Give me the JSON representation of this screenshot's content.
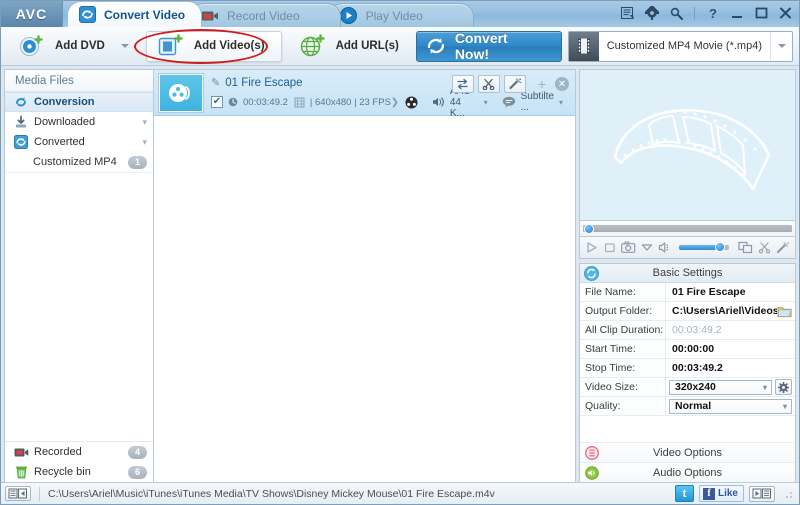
{
  "app": {
    "logo": "AVC"
  },
  "titlebar": {
    "tabs": [
      {
        "label": "Convert Video",
        "icon": "convert-icon",
        "active": true
      },
      {
        "label": "Record Video",
        "icon": "record-icon",
        "active": false
      },
      {
        "label": "Play Video",
        "icon": "play-icon",
        "active": false
      }
    ],
    "controls": [
      {
        "name": "activity-icon",
        "glyph": "▤"
      },
      {
        "name": "settings-gear-icon",
        "glyph": "✿"
      },
      {
        "name": "search-icon",
        "glyph": "🔍"
      },
      {
        "name": "help-button",
        "glyph": "?"
      },
      {
        "name": "minimize-button",
        "glyph": "—"
      },
      {
        "name": "maximize-button",
        "glyph": "❐"
      },
      {
        "name": "close-button",
        "glyph": "✕"
      }
    ]
  },
  "toolbar": {
    "add_dvd": "Add DVD",
    "add_videos": "Add Video(s)",
    "add_urls": "Add URL(s)",
    "convert_now": "Convert Now!",
    "profile": "Customized MP4 Movie (*.mp4)",
    "highlight_color": "#d21b1b"
  },
  "sidebar": {
    "header": "Media Files",
    "items": [
      {
        "label": "Conversion",
        "icon": "conversion-icon",
        "selected": true,
        "chevron": false,
        "badge": ""
      },
      {
        "label": "Downloaded",
        "icon": "downloaded-icon",
        "selected": false,
        "chevron": true,
        "badge": ""
      },
      {
        "label": "Converted",
        "icon": "converted-icon",
        "selected": false,
        "chevron": true,
        "badge": ""
      }
    ],
    "sub_item": {
      "label": "Customized MP4",
      "badge": "1"
    },
    "bottom_items": [
      {
        "label": "Recorded",
        "icon": "recorded-icon",
        "badge": "4"
      },
      {
        "label": "Recycle bin",
        "icon": "trash-icon",
        "badge": "6"
      }
    ]
  },
  "filelist": {
    "item": {
      "title": "01 Fire Escape",
      "duration": "00:03:49.2",
      "resolution": "640x480",
      "fps": "23 FPS",
      "separator": "|",
      "audio": "AAC 44 K...",
      "subtitle": "Subtilte ...",
      "checked": true
    },
    "actions": [
      {
        "name": "swap-icon",
        "glyph": "⇄"
      },
      {
        "name": "scissors-icon",
        "glyph": "✄"
      },
      {
        "name": "magic-wand-icon",
        "glyph": "✎"
      }
    ],
    "add_glyph": "+",
    "close_glyph": "✕"
  },
  "preview": {
    "playback_controls": [
      {
        "name": "play-icon",
        "glyph": "▷"
      },
      {
        "name": "stop-icon",
        "glyph": "◻"
      },
      {
        "name": "snapshot-camera-icon",
        "glyph": "▣"
      },
      {
        "name": "snapshot-dropdown-icon",
        "glyph": "▽"
      },
      {
        "name": "volume-icon",
        "glyph": "◁"
      },
      {
        "name": "window-icon",
        "glyph": "❐"
      },
      {
        "name": "cut-icon",
        "glyph": "✄"
      },
      {
        "name": "wand-icon",
        "glyph": "✎"
      }
    ]
  },
  "settings": {
    "title": "Basic Settings",
    "rows": [
      {
        "label": "File Name:",
        "value": "01 Fire Escape",
        "type": "text",
        "muted": false
      },
      {
        "label": "Output Folder:",
        "value": "C:\\Users\\Ariel\\Videos\\A...",
        "type": "folder",
        "muted": false
      },
      {
        "label": "All Clip Duration:",
        "value": "00:03:49.2",
        "type": "text",
        "muted": true
      },
      {
        "label": "Start Time:",
        "value": "00:00:00",
        "type": "text",
        "muted": false
      },
      {
        "label": "Stop Time:",
        "value": "00:03:49.2",
        "type": "text",
        "muted": false
      },
      {
        "label": "Video Size:",
        "value": "320x240",
        "type": "select-gear",
        "muted": false
      },
      {
        "label": "Quality:",
        "value": "Normal",
        "type": "select",
        "muted": false
      }
    ],
    "video_options": "Video Options",
    "audio_options": "Audio Options"
  },
  "statusbar": {
    "path": "C:\\Users\\Ariel\\Music\\iTunes\\iTunes Media\\TV Shows\\Disney Mickey Mouse\\01 Fire Escape.m4v",
    "twitter_glyph": "t",
    "facebook_glyph": "f",
    "like_label": "Like"
  }
}
